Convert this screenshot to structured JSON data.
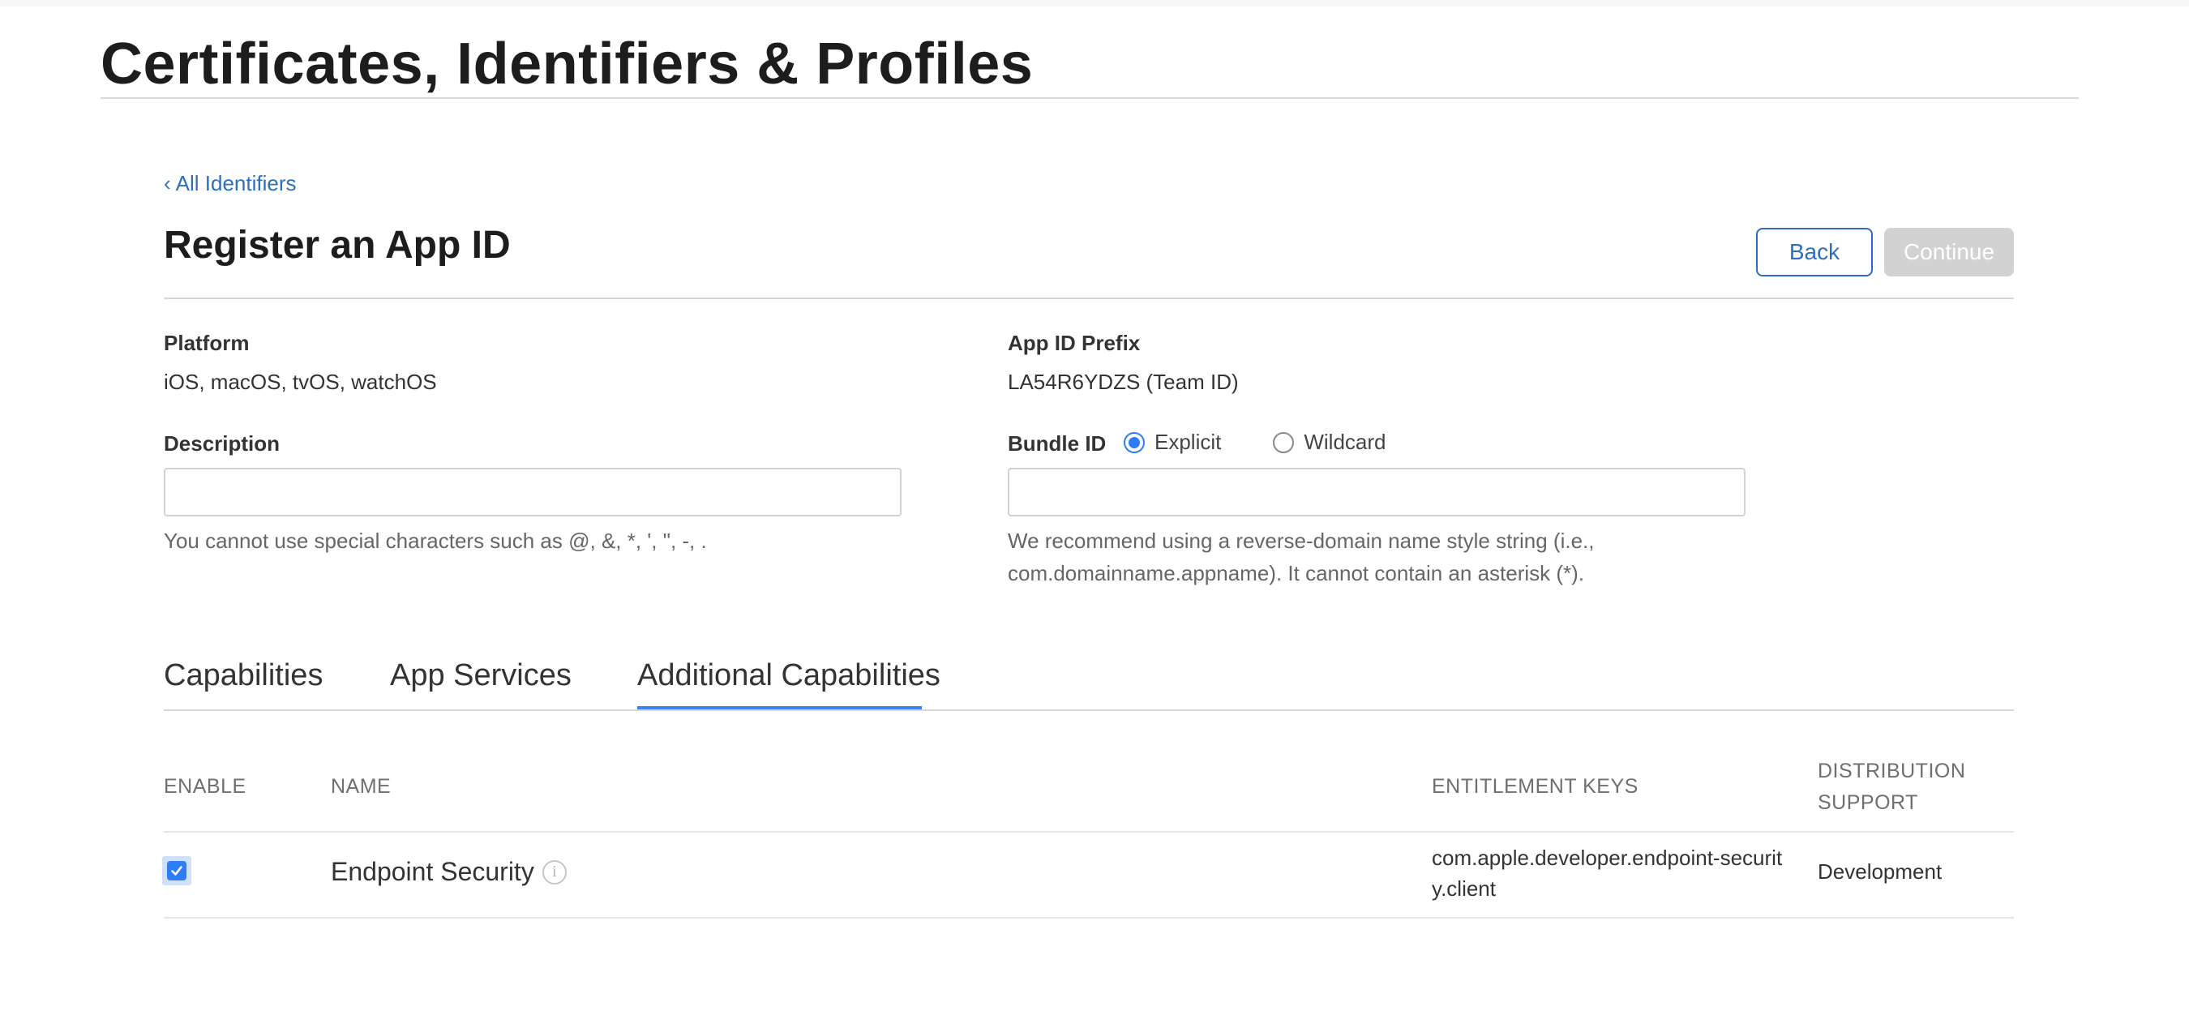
{
  "header": {
    "title": "Certificates, Identifiers & Profiles"
  },
  "nav": {
    "back_link": "All Identifiers",
    "back_chevron": "‹"
  },
  "section": {
    "title": "Register an App ID",
    "back_button": "Back",
    "continue_button": "Continue"
  },
  "form": {
    "platform_label": "Platform",
    "platform_value": "iOS, macOS, tvOS, watchOS",
    "prefix_label": "App ID Prefix",
    "prefix_value": "LA54R6YDZS (Team ID)",
    "description_label": "Description",
    "description_value": "",
    "description_hint": "You cannot use special characters such as @, &, *, ', \", -, .",
    "bundle_label": "Bundle ID",
    "bundle_options": [
      {
        "label": "Explicit",
        "checked": true
      },
      {
        "label": "Wildcard",
        "checked": false
      }
    ],
    "bundle_value": "",
    "bundle_hint_line1": "We recommend using a reverse-domain name style string (i.e.,",
    "bundle_hint_line2": "com.domainname.appname). It cannot contain an asterisk (*)."
  },
  "tabs": [
    {
      "label": "Capabilities",
      "active": false
    },
    {
      "label": "App Services",
      "active": false
    },
    {
      "label": "Additional Capabilities",
      "active": true
    }
  ],
  "table": {
    "headers": {
      "enable": "ENABLE",
      "name": "NAME",
      "entitlement_keys": "ENTITLEMENT KEYS",
      "distribution_line1": "DISTRIBUTION",
      "distribution_line2": "SUPPORT"
    },
    "rows": [
      {
        "enabled": true,
        "name": "Endpoint Security",
        "info_icon": "info-icon",
        "entitlement_key": "com.apple.developer.endpoint-security.client",
        "distribution": "Development"
      }
    ]
  },
  "colors": {
    "accent": "#2c6fbd",
    "tab_active": "#3b82f6",
    "checkbox": "#2f7df6",
    "disabled_button": "#d2d2d2"
  }
}
